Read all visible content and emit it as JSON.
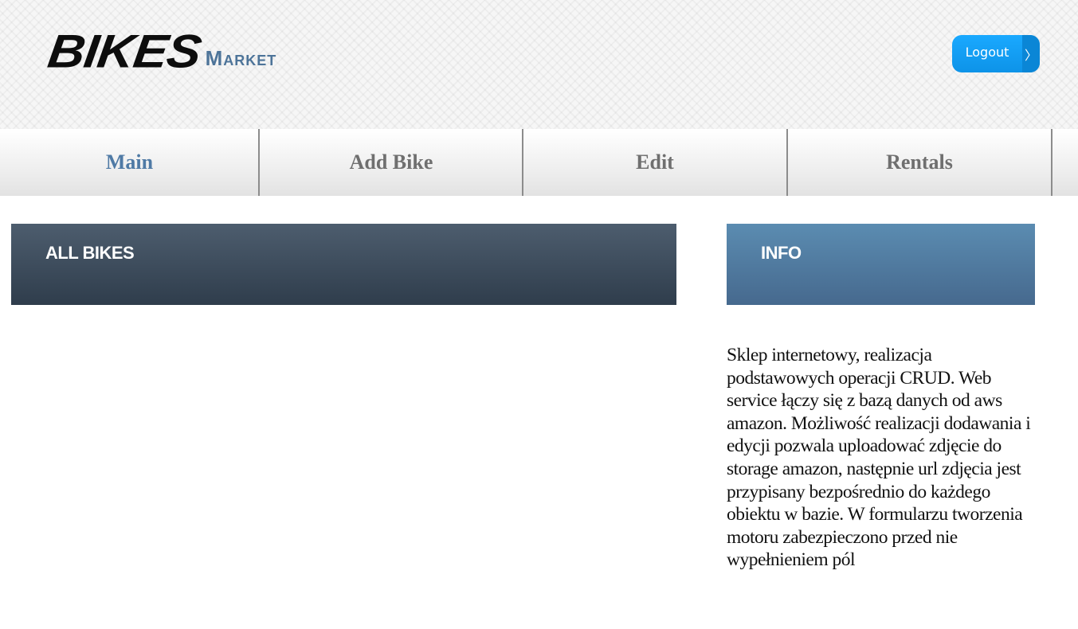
{
  "header": {
    "logo": {
      "primary": "BIKES",
      "secondary": "Market"
    },
    "logout_label": "Logout",
    "logout_arrow": "〉"
  },
  "nav": {
    "items": [
      {
        "label": "Main",
        "active": true
      },
      {
        "label": "Add Bike",
        "active": false
      },
      {
        "label": "Edit",
        "active": false
      },
      {
        "label": "Rentals",
        "active": false
      }
    ]
  },
  "main": {
    "all_bikes_title": "ALL BIKES"
  },
  "sidebar": {
    "info_title": "INFO",
    "info_text": "Sklep internetowy, realizacja podstawowych operacji CRUD. Web service łączy się z bazą danych od aws amazon. Możliwość realizacji dodawania i edycji pozwala uploadować zdjęcie do storage amazon, następnie url zdjęcia jest przypisany bezpośrednio do każdego obiektu w bazie. W formularzu tworzenia motoru zabezpieczono przed nie wypełnieniem pól"
  },
  "colors": {
    "brand_blue": "#4d7499",
    "logout_blue": "#1aa9ff",
    "all_bikes_header": "#3d4b5b",
    "info_header": "#5281a6",
    "nav_active": "#4f7aa5",
    "nav_inactive": "#6f6f6f"
  }
}
